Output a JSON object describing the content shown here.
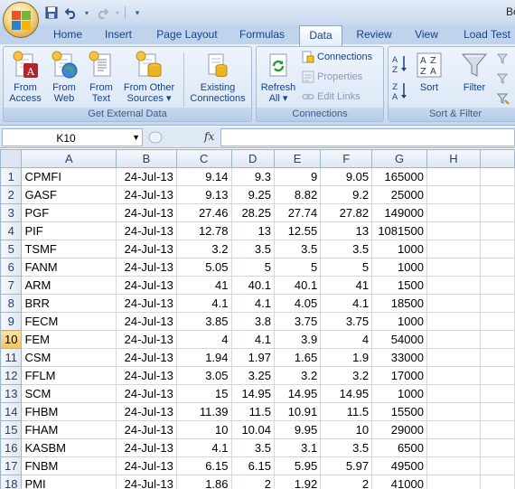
{
  "window": {
    "title_partial": "Bo"
  },
  "tabs": [
    "Home",
    "Insert",
    "Page Layout",
    "Formulas",
    "Data",
    "Review",
    "View",
    "Load Test"
  ],
  "active_tab": "Data",
  "ribbon": {
    "get_external": {
      "label": "Get External Data",
      "buttons": [
        {
          "line1": "From",
          "line2": "Access"
        },
        {
          "line1": "From",
          "line2": "Web"
        },
        {
          "line1": "From",
          "line2": "Text"
        },
        {
          "line1": "From Other",
          "line2": "Sources ▾"
        },
        {
          "line1": "Existing",
          "line2": "Connections"
        }
      ]
    },
    "connections": {
      "label": "Connections",
      "refresh": {
        "line1": "Refresh",
        "line2": "All ▾"
      },
      "connections_btn": "Connections",
      "properties_btn": "Properties",
      "edit_links_btn": "Edit Links"
    },
    "sort_filter": {
      "label": "Sort & Filter",
      "sort": "Sort",
      "filter": "Filter"
    }
  },
  "formula_bar": {
    "name_box": "K10",
    "fx": "fx",
    "formula": ""
  },
  "columns": [
    "A",
    "B",
    "C",
    "D",
    "E",
    "F",
    "G",
    "H"
  ],
  "selected_row": 10,
  "rows": [
    {
      "n": "1",
      "a": "CPMFI",
      "b": "24-Jul-13",
      "c": "9.14",
      "d": "9.3",
      "e": "9",
      "f": "9.05",
      "g": "165000"
    },
    {
      "n": "2",
      "a": "GASF",
      "b": "24-Jul-13",
      "c": "9.13",
      "d": "9.25",
      "e": "8.82",
      "f": "9.2",
      "g": "25000"
    },
    {
      "n": "3",
      "a": "PGF",
      "b": "24-Jul-13",
      "c": "27.46",
      "d": "28.25",
      "e": "27.74",
      "f": "27.82",
      "g": "149000"
    },
    {
      "n": "4",
      "a": "PIF",
      "b": "24-Jul-13",
      "c": "12.78",
      "d": "13",
      "e": "12.55",
      "f": "13",
      "g": "1081500"
    },
    {
      "n": "5",
      "a": "TSMF",
      "b": "24-Jul-13",
      "c": "3.2",
      "d": "3.5",
      "e": "3.5",
      "f": "3.5",
      "g": "1000"
    },
    {
      "n": "6",
      "a": "FANM",
      "b": "24-Jul-13",
      "c": "5.05",
      "d": "5",
      "e": "5",
      "f": "5",
      "g": "1000"
    },
    {
      "n": "7",
      "a": "ARM",
      "b": "24-Jul-13",
      "c": "41",
      "d": "40.1",
      "e": "40.1",
      "f": "41",
      "g": "1500"
    },
    {
      "n": "8",
      "a": "BRR",
      "b": "24-Jul-13",
      "c": "4.1",
      "d": "4.1",
      "e": "4.05",
      "f": "4.1",
      "g": "18500"
    },
    {
      "n": "9",
      "a": "FECM",
      "b": "24-Jul-13",
      "c": "3.85",
      "d": "3.8",
      "e": "3.75",
      "f": "3.75",
      "g": "1000"
    },
    {
      "n": "10",
      "a": "FEM",
      "b": "24-Jul-13",
      "c": "4",
      "d": "4.1",
      "e": "3.9",
      "f": "4",
      "g": "54000"
    },
    {
      "n": "11",
      "a": "CSM",
      "b": "24-Jul-13",
      "c": "1.94",
      "d": "1.97",
      "e": "1.65",
      "f": "1.9",
      "g": "33000"
    },
    {
      "n": "12",
      "a": "FFLM",
      "b": "24-Jul-13",
      "c": "3.05",
      "d": "3.25",
      "e": "3.2",
      "f": "3.2",
      "g": "17000"
    },
    {
      "n": "13",
      "a": "SCM",
      "b": "24-Jul-13",
      "c": "15",
      "d": "14.95",
      "e": "14.95",
      "f": "14.95",
      "g": "1000"
    },
    {
      "n": "14",
      "a": "FHBM",
      "b": "24-Jul-13",
      "c": "11.39",
      "d": "11.5",
      "e": "10.91",
      "f": "11.5",
      "g": "15500"
    },
    {
      "n": "15",
      "a": "FHAM",
      "b": "24-Jul-13",
      "c": "10",
      "d": "10.04",
      "e": "9.95",
      "f": "10",
      "g": "29000"
    },
    {
      "n": "16",
      "a": "KASBM",
      "b": "24-Jul-13",
      "c": "4.1",
      "d": "3.5",
      "e": "3.1",
      "f": "3.5",
      "g": "6500"
    },
    {
      "n": "17",
      "a": "FNBM",
      "b": "24-Jul-13",
      "c": "6.15",
      "d": "6.15",
      "e": "5.95",
      "f": "5.97",
      "g": "49500"
    },
    {
      "n": "18",
      "a": "PMI",
      "b": "24-Jul-13",
      "c": "1.86",
      "d": "2",
      "e": "1.92",
      "f": "2",
      "g": "41000"
    }
  ]
}
